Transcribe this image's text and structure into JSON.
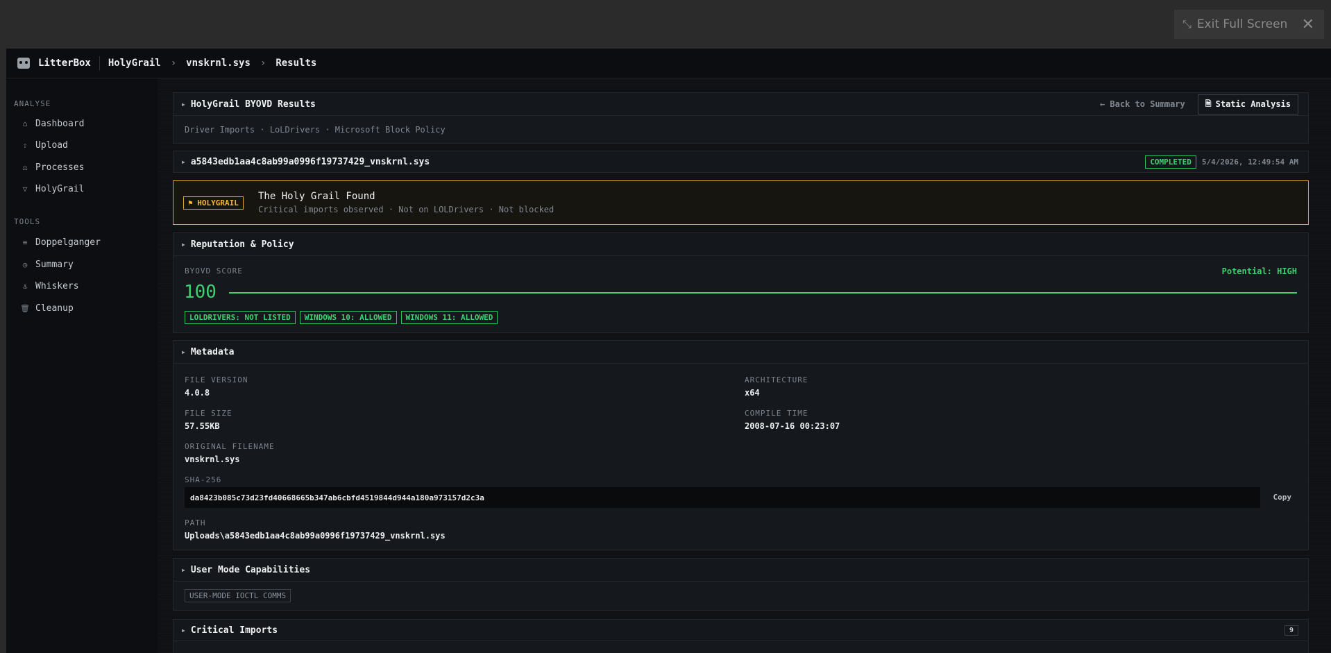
{
  "fullscreen": {
    "exit_label": "Exit Full Screen"
  },
  "topbar": {
    "brand": "LitterBox",
    "breadcrumbs": [
      "HolyGrail",
      "vnskrnl.sys",
      "Results"
    ]
  },
  "sidebar": {
    "analyse_heading": "ANALYSE",
    "analyse_items": [
      {
        "label": "Dashboard",
        "icon": "home-icon"
      },
      {
        "label": "Upload",
        "icon": "upload-icon"
      },
      {
        "label": "Processes",
        "icon": "scale-icon"
      },
      {
        "label": "HolyGrail",
        "icon": "triangle-down-icon"
      }
    ],
    "tools_heading": "TOOLS",
    "tools_items": [
      {
        "label": "Doppelganger",
        "icon": "list-icon"
      },
      {
        "label": "Summary",
        "icon": "clock-icon"
      },
      {
        "label": "Whiskers",
        "icon": "anchor-icon"
      },
      {
        "label": "Cleanup",
        "icon": "trash-icon"
      }
    ]
  },
  "results_panel": {
    "title": "HolyGrail BYOVD Results",
    "back_label": "Back to Summary",
    "static_label": "Static Analysis",
    "subtitle": "Driver Imports · LoLDrivers · Microsoft Block Policy"
  },
  "file_panel": {
    "filename": "a5843edb1aa4c8ab99a0996f19737429_vnskrnl.sys",
    "status": "COMPLETED",
    "timestamp": "5/4/2026, 12:49:54 AM"
  },
  "verdict": {
    "badge": "⚑ HOLYGRAIL",
    "title": "The Holy Grail Found",
    "detail": "Critical imports observed · Not on LOLDrivers · Not blocked"
  },
  "reputation": {
    "title": "Reputation & Policy",
    "score_label": "BYOVD SCORE",
    "potential": "Potential: HIGH",
    "score": "100",
    "score_fraction": 1.0,
    "tags": [
      "LOLDRIVERS: NOT LISTED",
      "WINDOWS 10: ALLOWED",
      "WINDOWS 11: ALLOWED"
    ]
  },
  "metadata": {
    "title": "Metadata",
    "file_version_label": "FILE VERSION",
    "file_version": "4.0.8",
    "architecture_label": "ARCHITECTURE",
    "architecture": "x64",
    "file_size_label": "FILE SIZE",
    "file_size": "57.55KB",
    "compile_time_label": "COMPILE TIME",
    "compile_time": "2008-07-16 00:23:07",
    "original_filename_label": "ORIGINAL FILENAME",
    "original_filename": "vnskrnl.sys",
    "sha_label": "SHA-256",
    "sha": "da8423b085c73d23fd40668665b347ab6cbfd4519844d944a180a973157d2c3a",
    "copy_label": "Copy",
    "path_label": "PATH",
    "path": "Uploads\\a5843edb1aa4c8ab99a0996f19737429_vnskrnl.sys"
  },
  "capabilities": {
    "title": "User Mode Capabilities",
    "tag": "USER-MODE IOCTL COMMS"
  },
  "critical_imports": {
    "title": "Critical Imports",
    "count": "9"
  },
  "colors": {
    "accent_green": "#3ecf6e",
    "holygrail_amber": "#e0a82e",
    "background": "#0d0f12"
  }
}
